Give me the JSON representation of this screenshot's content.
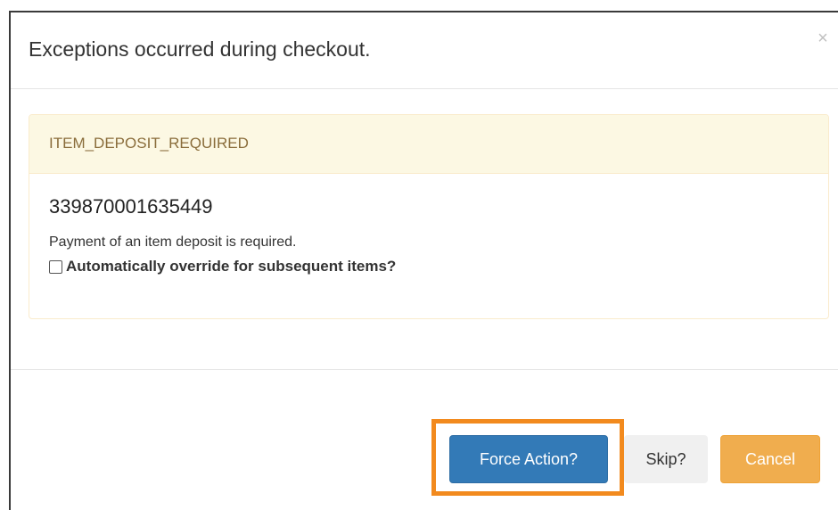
{
  "dialog": {
    "title": "Exceptions occurred during checkout.",
    "close_label": "×"
  },
  "exception": {
    "code": "ITEM_DEPOSIT_REQUIRED",
    "barcode": "339870001635449",
    "message": "Payment of an item deposit is required.",
    "override_label": "Automatically override for subsequent items?",
    "override_checked": false
  },
  "footer": {
    "force_label": "Force Action?",
    "skip_label": "Skip?",
    "cancel_label": "Cancel"
  },
  "colors": {
    "warning_bg": "#fcf8e3",
    "warning_text": "#8a6d3b",
    "primary": "#337ab7",
    "cancel": "#f0ad4e",
    "highlight": "#f28a1e"
  }
}
